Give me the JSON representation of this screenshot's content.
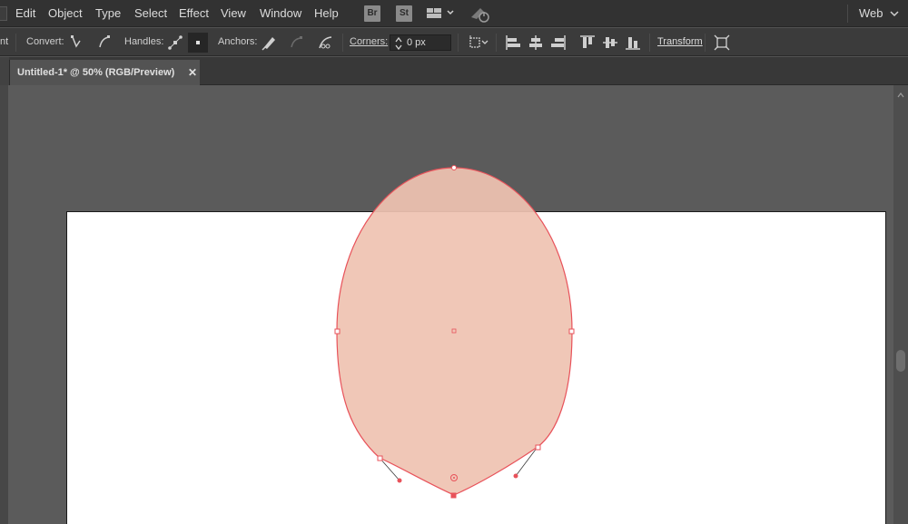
{
  "menu": {
    "items": [
      "Edit",
      "Object",
      "Type",
      "Select",
      "Effect",
      "View",
      "Window",
      "Help"
    ],
    "bridge_badge": "Br",
    "stock_badge": "St",
    "arrange_icon": "arrange-documents-icon",
    "gpu_icon": "gpu-performance-icon",
    "workspace": "Web"
  },
  "control": {
    "cut_label": "nt",
    "convert_label": "Convert:",
    "handles_label": "Handles:",
    "anchors_label": "Anchors:",
    "corners_label": "Corners:",
    "corners_value": "0 px",
    "transform_label": "Transform"
  },
  "document": {
    "tab_title": "Untitled-1* @ 50% (RGB/Preview)",
    "close_glyph": "✕"
  },
  "colors": {
    "shape_fill": "#efc3b1",
    "selection": "#e8525a",
    "artboard": "#ffffff",
    "canvas": "#5b5b5b"
  }
}
